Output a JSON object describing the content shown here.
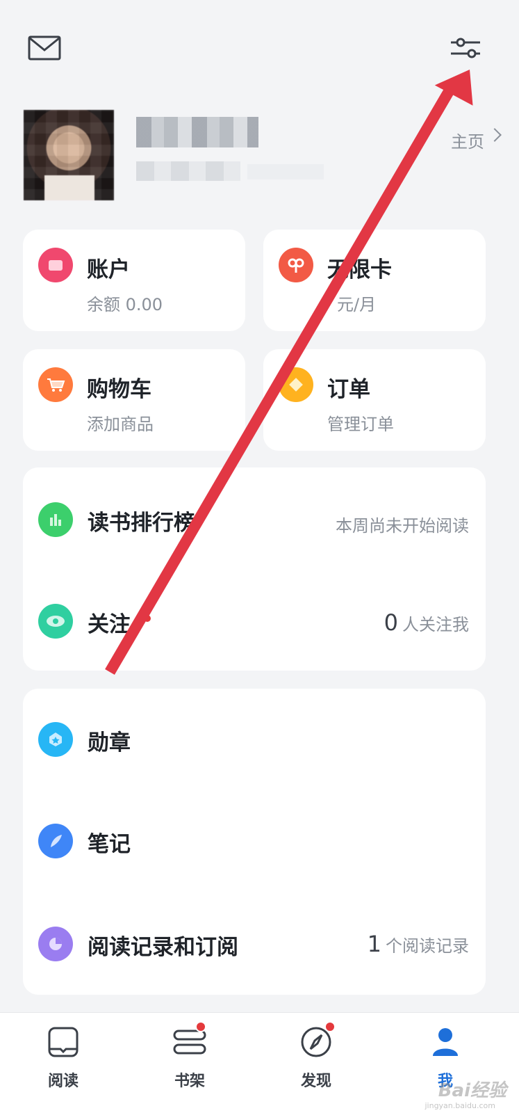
{
  "header": {
    "mail_icon": "mail-icon",
    "settings_icon": "sliders-icon"
  },
  "profile": {
    "homepage_label": "主页"
  },
  "cards": {
    "account": {
      "title": "账户",
      "sub": "余额 0.00",
      "color": "#f0486e"
    },
    "unlimited": {
      "title": "无限卡",
      "sub": "元/月",
      "color": "#f25a45"
    },
    "cart": {
      "title": "购物车",
      "sub": "添加商品",
      "color": "#ff7a3d"
    },
    "orders": {
      "title": "订单",
      "sub": "管理订单",
      "color": "#ffb21f"
    }
  },
  "list1": {
    "ranking": {
      "title": "读书排行榜",
      "right": "本周尚未开始阅读",
      "color": "#3ccf6c"
    },
    "follow": {
      "title": "关注",
      "count": "0",
      "right": "人关注我",
      "color": "#2fcfa0"
    }
  },
  "list2": {
    "badges": {
      "title": "勋章",
      "color": "#27b6f5"
    },
    "notes": {
      "title": "笔记",
      "color": "#3f86f7"
    },
    "history": {
      "title": "阅读记录和订阅",
      "count": "1",
      "right": "个阅读记录",
      "color": "#9a7df0"
    }
  },
  "nav": {
    "items": [
      {
        "label": "阅读"
      },
      {
        "label": "书架"
      },
      {
        "label": "发现"
      },
      {
        "label": "我"
      }
    ]
  },
  "watermark": {
    "text": "Bai经验",
    "sub": "jingyan.baidu.com"
  }
}
